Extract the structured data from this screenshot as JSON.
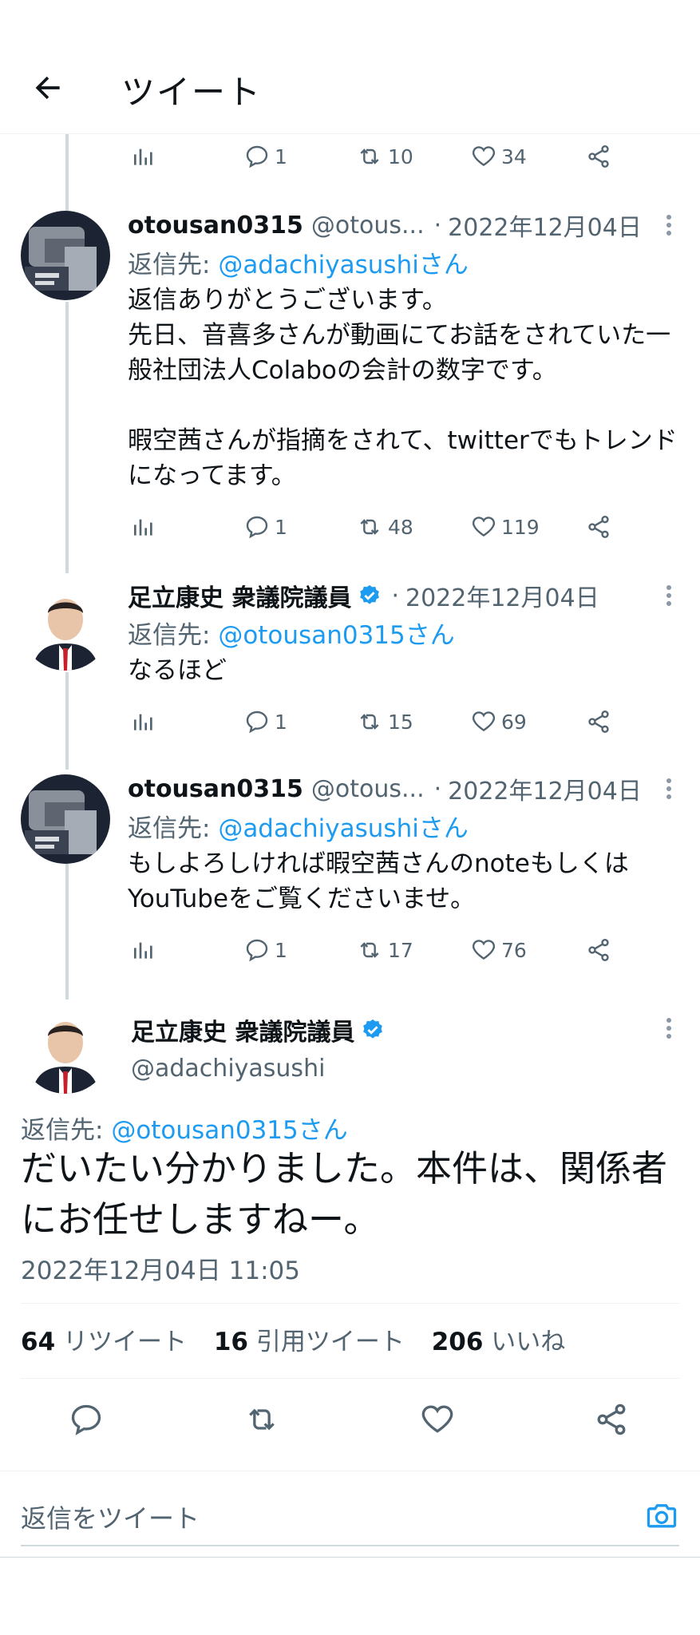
{
  "header": {
    "title": "ツイート"
  },
  "top_stats": {
    "reply_count": "1",
    "retweet_count": "10",
    "like_count": "34"
  },
  "tweets": [
    {
      "name": "otousan0315",
      "handle": "@otous...",
      "date": "2022年12月04日",
      "reply_prefix": "返信先: ",
      "reply_to": "@adachiyasushiさん",
      "text": "返信ありがとうございます。\n先日、音喜多さんが動画にてお話をされていた一般社団法人Colaboの会計の数字です。\n\n暇空茜さんが指摘をされて、twitterでもトレンドになってます。",
      "reply_count": "1",
      "retweet_count": "48",
      "like_count": "119"
    },
    {
      "name": "足立康史 衆議院議員",
      "handle": "",
      "date": "2022年12月04日",
      "reply_prefix": "返信先: ",
      "reply_to": "@otousan0315さん",
      "text": "なるほど",
      "reply_count": "1",
      "retweet_count": "15",
      "like_count": "69"
    },
    {
      "name": "otousan0315",
      "handle": "@otous...",
      "date": "2022年12月04日",
      "reply_prefix": "返信先: ",
      "reply_to": "@adachiyasushiさん",
      "text": "もしよろしければ暇空茜さんのnoteもしくはYouTubeをご覧くださいませ。",
      "reply_count": "1",
      "retweet_count": "17",
      "like_count": "76"
    }
  ],
  "main_tweet": {
    "name": "足立康史 衆議院議員",
    "handle": "@adachiyasushi",
    "reply_prefix": "返信先: ",
    "reply_to": "@otousan0315さん",
    "text": "だいたい分かりました。本件は、関係者にお任せしますねー。",
    "timestamp": "2022年12月04日 11:05",
    "retweets": "64",
    "retweets_label": "リツイート",
    "quotes": "16",
    "quotes_label": "引用ツイート",
    "likes": "206",
    "likes_label": "いいね"
  },
  "compose": {
    "placeholder": "返信をツイート"
  },
  "colors": {
    "accent": "#1d9bf0",
    "muted": "#536471",
    "text": "#0f1419",
    "thread_line": "#cfd9de"
  },
  "icons": [
    "back-arrow-icon",
    "analytics-icon",
    "reply-icon",
    "retweet-icon",
    "like-icon",
    "share-icon",
    "more-icon",
    "verified-icon",
    "camera-icon"
  ]
}
